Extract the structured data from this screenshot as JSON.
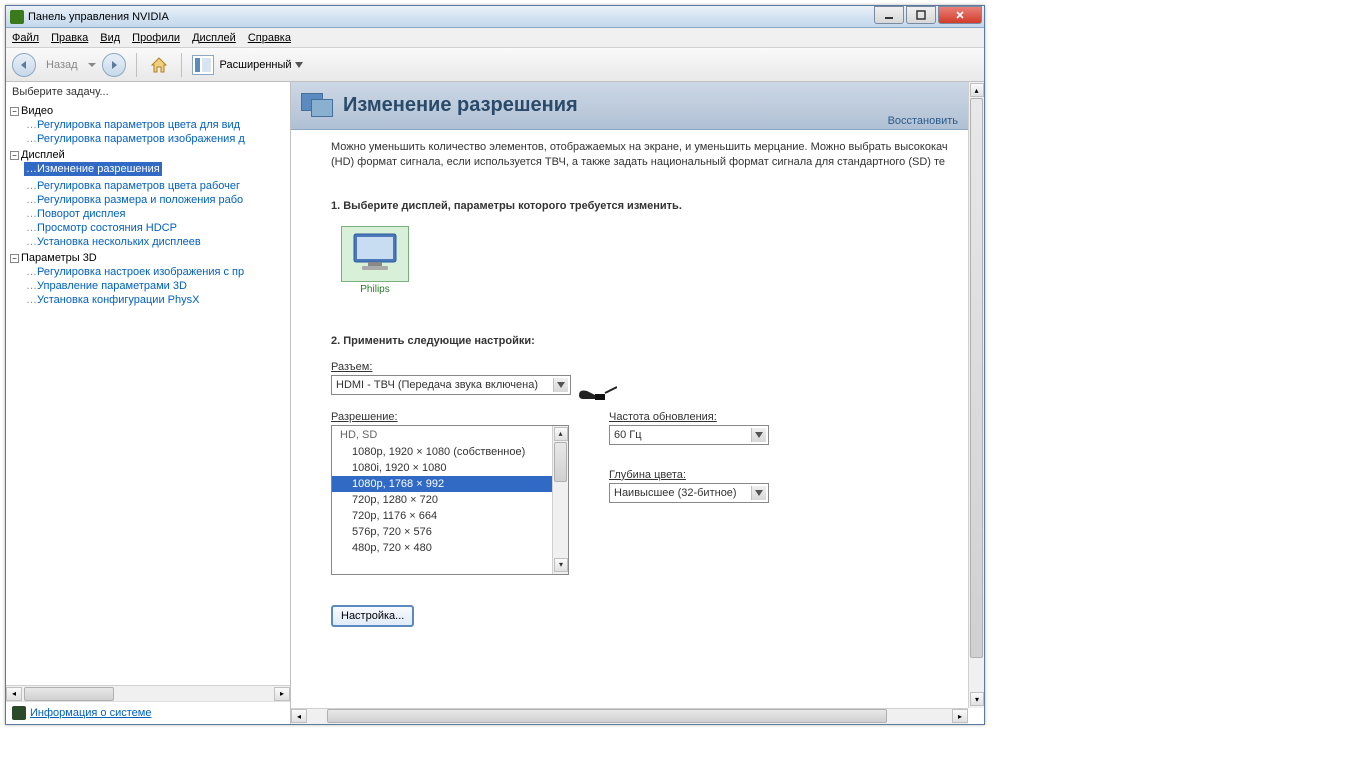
{
  "window": {
    "title": "Панель управления NVIDIA"
  },
  "menubar": {
    "file": "Файл",
    "edit": "Правка",
    "view": "Вид",
    "profiles": "Профили",
    "display": "Дисплей",
    "help": "Справка"
  },
  "toolbar": {
    "back": "Назад",
    "view_dropdown": "Расширенный"
  },
  "sidebar": {
    "header": "Выберите задачу...",
    "groups": [
      {
        "label": "Видео",
        "items": [
          "Регулировка параметров цвета для вид",
          "Регулировка параметров изображения д"
        ]
      },
      {
        "label": "Дисплей",
        "items": [
          "Изменение разрешения",
          "Регулировка параметров цвета рабочег",
          "Регулировка размера и положения рабо",
          "Поворот дисплея",
          "Просмотр состояния HDCP",
          "Установка нескольких дисплеев"
        ]
      },
      {
        "label": "Параметры 3D",
        "items": [
          "Регулировка настроек изображения с пр",
          "Управление параметрами 3D",
          "Установка конфигурации PhysX"
        ]
      }
    ],
    "footer_link": "Информация о системе"
  },
  "page": {
    "title": "Изменение разрешения",
    "restore": "Восстановить",
    "description": "Можно уменьшить количество элементов, отображаемых на экране, и уменьшить мерцание. Можно выбрать высококач (HD) формат сигнала, если используется ТВЧ, а также задать национальный формат сигнала для стандартного (SD) те",
    "step1": "1. Выберите дисплей, параметры которого требуется изменить.",
    "display_name": "Philips",
    "step2": "2. Применить следующие настройки:",
    "connector_label": "Разъем:",
    "connector_value": "HDMI - ТВЧ (Передача звука включена)",
    "resolution_label": "Разрешение:",
    "refresh_label": "Частота обновления:",
    "refresh_value": "60 Гц",
    "depth_label": "Глубина цвета:",
    "depth_value": "Наивысшее (32-битное)",
    "list_header": "HD, SD",
    "resolutions": [
      "1080p, 1920 × 1080 (собственное)",
      "1080i, 1920 × 1080",
      "1080p, 1768 × 992",
      "720p, 1280 × 720",
      "720p, 1176 × 664",
      "576p, 720 × 576",
      "480p, 720 × 480"
    ],
    "selected_resolution": 2,
    "settings_button": "Настройка..."
  }
}
